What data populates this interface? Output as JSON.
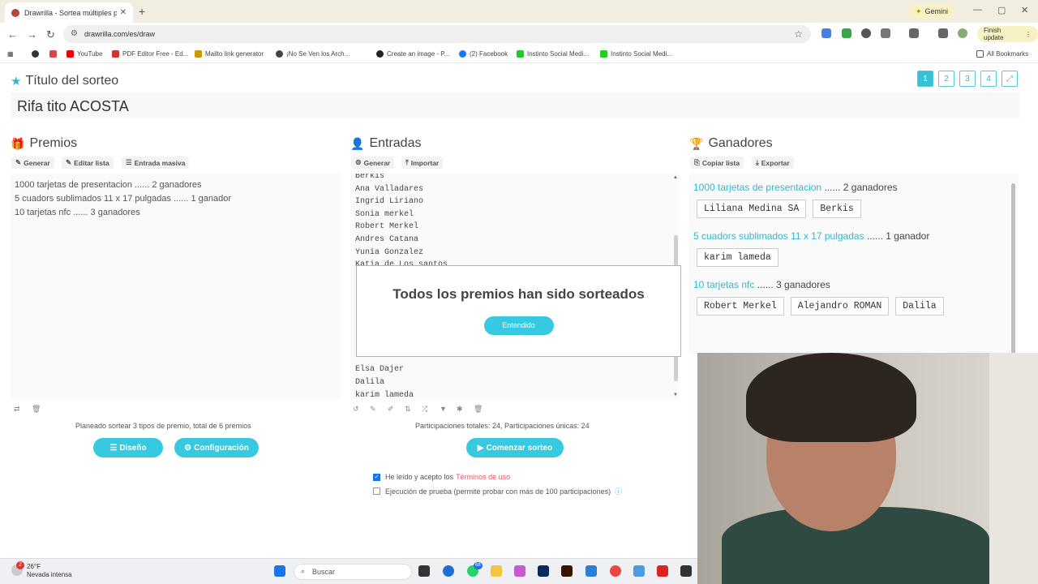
{
  "browser": {
    "tab_title": "Drawrilla - Sortea múltiples pre",
    "url": "drawrilla.com/es/draw",
    "gemini_label": "Gemini",
    "finish_update_label": "Finish update",
    "all_bookmarks_label": "All Bookmarks",
    "bookmarks": [
      "YouTube",
      "PDF Editor Free - Ed...",
      "Mailto link generator",
      "¡No Se Ven los Arch...",
      "Create an image - P...",
      "(2) Facebook",
      "Instinto Social Medi...",
      "Instinto Social Medi..."
    ]
  },
  "page": {
    "title_label": "Título del sorteo",
    "title_value": "Rifa tito ACOSTA",
    "pages": [
      "1",
      "2",
      "3",
      "4"
    ],
    "active_page": "1"
  },
  "premios": {
    "heading": "Premios",
    "btn_generar": "Generar",
    "btn_editar": "Editar lista",
    "btn_masiva": "Entrada masiva",
    "items": [
      "1000 tarjetas de presentacion ...... 2 ganadores",
      "5 cuadors sublimados 11 x 17 pulgadas ...... 1 ganador",
      "10 tarjetas nfc ...... 3 ganadores"
    ],
    "summary": "Planeado sortear 3 tipos de premio, total de 6 premios",
    "btn_diseno": "Diseño",
    "btn_config": "Configuración"
  },
  "entradas": {
    "heading": "Entradas",
    "btn_generar": "Generar",
    "btn_importar": "Importar",
    "items": [
      "Berkis",
      "Ana Valladares",
      "Ingrid Liriano",
      "Sonia merkel",
      "Robert Merkel",
      "Andres Catana",
      "Yunia Gonzalez",
      "Katia de Los santos"
    ],
    "items_bottom": [
      "Elsa Dajer",
      "Dalila",
      "karim lameda"
    ],
    "summary": "Participaciones totales: 24, Participaciones únicas: 24",
    "btn_comenzar": "Comenzar sorteo",
    "terms_text": "He leído y acepto los",
    "terms_link": "Términos de uso",
    "trial_text": "Ejecución de prueba (permite probar con más de 100 participaciones)"
  },
  "ganadores": {
    "heading": "Ganadores",
    "btn_copiar": "Copiar lista",
    "btn_exportar": "Exportar",
    "prizes": [
      {
        "name": "1000 tarjetas de presentacion",
        "count": " ...... 2 ganadores",
        "winners": [
          "Liliana Medina SA",
          "Berkis"
        ]
      },
      {
        "name": "5 cuadors sublimados 11 x 17 pulgadas",
        "count": " ...... 1 ganador",
        "winners": [
          "karim lameda"
        ]
      },
      {
        "name": "10 tarjetas nfc",
        "count": " ...... 3 ganadores",
        "winners": [
          "Robert Merkel",
          "Alejandro ROMAN",
          "Dalila"
        ]
      }
    ]
  },
  "modal": {
    "message": "Todos los premios han sido sorteados",
    "button": "Entendido"
  },
  "taskbar": {
    "temperature": "26°F",
    "weather": "Nevada intensa",
    "search_placeholder": "Buscar",
    "notif_count": "2",
    "whatsapp_badge": "68"
  }
}
